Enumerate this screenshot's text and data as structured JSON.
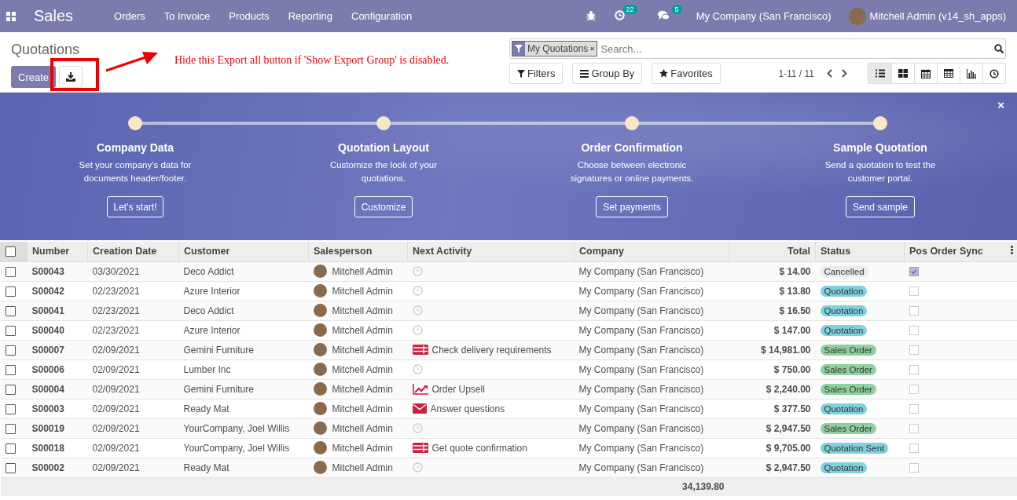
{
  "navbar": {
    "app": "Sales",
    "menu": [
      "Orders",
      "To Invoice",
      "Products",
      "Reporting",
      "Configuration"
    ],
    "activity_count": "22",
    "message_count": "5",
    "company": "My Company (San Francisco)",
    "user": "Mitchell Admin (v14_sh_apps)"
  },
  "control_panel": {
    "title": "Quotations",
    "create": "Create",
    "annotation": "Hide this Export all  button if 'Show Export Group' is disabled.",
    "facet": "My Quotations",
    "search_placeholder": "Search...",
    "filters": "Filters",
    "group_by": "Group By",
    "favorites": "Favorites",
    "pager": "1-11 / 11",
    "views": [
      {
        "kind": "list",
        "selected": true
      },
      {
        "kind": "kanban",
        "selected": false
      },
      {
        "kind": "calendar",
        "selected": false
      },
      {
        "kind": "pivot",
        "selected": false
      },
      {
        "kind": "graph",
        "selected": false
      },
      {
        "kind": "activity",
        "selected": false
      }
    ]
  },
  "onboarding": {
    "close": "×",
    "steps": [
      {
        "title": "Company Data",
        "text": "Set your company's data for documents header/footer.",
        "button": "Let's start!"
      },
      {
        "title": "Quotation Layout",
        "text": "Customize the look of your quotations.",
        "button": "Customize"
      },
      {
        "title": "Order Confirmation",
        "text": "Choose between electronic signatures or online payments.",
        "button": "Set payments"
      },
      {
        "title": "Sample Quotation",
        "text": "Send a quotation to test the customer portal.",
        "button": "Send sample"
      }
    ]
  },
  "table": {
    "select_all": false,
    "columns": [
      "Number",
      "Creation Date",
      "Customer",
      "Salesperson",
      "Next Activity",
      "Company",
      "Total",
      "Status",
      "Pos Order Sync"
    ],
    "rows": [
      {
        "selected": false,
        "number": "S00043",
        "date": "03/30/2021",
        "customer": "Deco Addict",
        "salesperson": "Mitchell Admin",
        "activity": {
          "kind": "none"
        },
        "company": "My Company (San Francisco)",
        "total": "$ 14.00",
        "status": {
          "label": "Cancelled",
          "color": "#e9ecef"
        },
        "pos_sync": true
      },
      {
        "selected": false,
        "number": "S00042",
        "date": "02/23/2021",
        "customer": "Azure Interior",
        "salesperson": "Mitchell Admin",
        "activity": {
          "kind": "none"
        },
        "company": "My Company (San Francisco)",
        "total": "$ 13.80",
        "status": {
          "label": "Quotation",
          "color": "#7fd1de"
        },
        "pos_sync": false
      },
      {
        "selected": false,
        "number": "S00041",
        "date": "02/23/2021",
        "customer": "Deco Addict",
        "salesperson": "Mitchell Admin",
        "activity": {
          "kind": "none"
        },
        "company": "My Company (San Francisco)",
        "total": "$ 16.50",
        "status": {
          "label": "Quotation",
          "color": "#7fd1de"
        },
        "pos_sync": false
      },
      {
        "selected": false,
        "number": "S00040",
        "date": "02/23/2021",
        "customer": "Azure Interior",
        "salesperson": "Mitchell Admin",
        "activity": {
          "kind": "none"
        },
        "company": "My Company (San Francisco)",
        "total": "$ 147.00",
        "status": {
          "label": "Quotation",
          "color": "#7fd1de"
        },
        "pos_sync": false
      },
      {
        "selected": false,
        "number": "S00007",
        "date": "02/09/2021",
        "customer": "Gemini Furniture",
        "salesperson": "Mitchell Admin",
        "activity": {
          "kind": "tasks",
          "label": "Check delivery requirements"
        },
        "company": "My Company (San Francisco)",
        "total": "$ 14,981.00",
        "status": {
          "label": "Sales Order",
          "color": "#8fd19e"
        },
        "pos_sync": false
      },
      {
        "selected": false,
        "number": "S00006",
        "date": "02/09/2021",
        "customer": "Lumber Inc",
        "salesperson": "Mitchell Admin",
        "activity": {
          "kind": "none"
        },
        "company": "My Company (San Francisco)",
        "total": "$ 750.00",
        "status": {
          "label": "Sales Order",
          "color": "#8fd19e"
        },
        "pos_sync": false
      },
      {
        "selected": false,
        "number": "S00004",
        "date": "02/09/2021",
        "customer": "Gemini Furniture",
        "salesperson": "Mitchell Admin",
        "activity": {
          "kind": "upsell",
          "label": "Order Upsell"
        },
        "company": "My Company (San Francisco)",
        "total": "$ 2,240.00",
        "status": {
          "label": "Sales Order",
          "color": "#8fd19e"
        },
        "pos_sync": false
      },
      {
        "selected": false,
        "number": "S00003",
        "date": "02/09/2021",
        "customer": "Ready Mat",
        "salesperson": "Mitchell Admin",
        "activity": {
          "kind": "email",
          "label": "Answer questions"
        },
        "company": "My Company (San Francisco)",
        "total": "$ 377.50",
        "status": {
          "label": "Quotation",
          "color": "#7fd1de"
        },
        "pos_sync": false
      },
      {
        "selected": false,
        "number": "S00019",
        "date": "02/09/2021",
        "customer": "YourCompany, Joel Willis",
        "salesperson": "Mitchell Admin",
        "activity": {
          "kind": "none"
        },
        "company": "My Company (San Francisco)",
        "total": "$ 2,947.50",
        "status": {
          "label": "Sales Order",
          "color": "#8fd19e"
        },
        "pos_sync": false
      },
      {
        "selected": false,
        "number": "S00018",
        "date": "02/09/2021",
        "customer": "YourCompany, Joel Willis",
        "salesperson": "Mitchell Admin",
        "activity": {
          "kind": "tasks",
          "label": "Get quote confirmation"
        },
        "company": "My Company (San Francisco)",
        "total": "$ 9,705.00",
        "status": {
          "label": "Quotation Sent",
          "color": "#7fd1de"
        },
        "pos_sync": false
      },
      {
        "selected": false,
        "number": "S00002",
        "date": "02/09/2021",
        "customer": "Ready Mat",
        "salesperson": "Mitchell Admin",
        "activity": {
          "kind": "none"
        },
        "company": "My Company (San Francisco)",
        "total": "$ 2,947.50",
        "status": {
          "label": "Quotation",
          "color": "#7fd1de"
        },
        "pos_sync": false
      }
    ],
    "sum_total": "34,139.80"
  }
}
